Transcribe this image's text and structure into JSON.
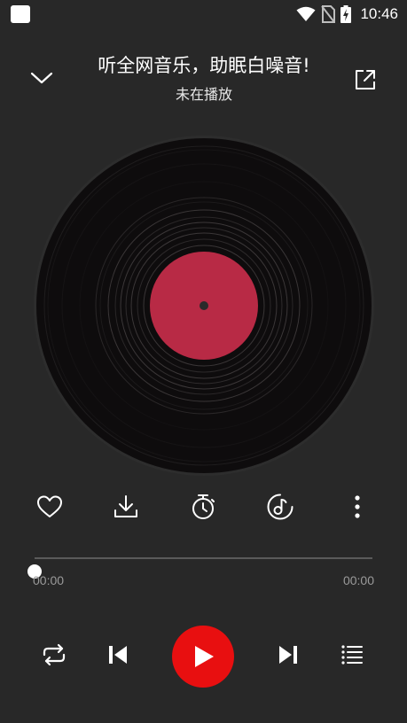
{
  "status_bar": {
    "time": "10:46",
    "icons": [
      "app-notification-icon",
      "wifi-icon",
      "no-sim-icon",
      "battery-charging-icon"
    ]
  },
  "header": {
    "title": "听全网音乐，助眠白噪音!",
    "subtitle": "未在播放",
    "left_icon": "chevron-down-icon",
    "right_icon": "share-external-icon"
  },
  "disc": {
    "label_color": "#b82a45",
    "disc_color": "#0e0c0d"
  },
  "actions": [
    {
      "name": "favorite",
      "icon": "heart-icon"
    },
    {
      "name": "download",
      "icon": "download-icon"
    },
    {
      "name": "sleep-timer",
      "icon": "timer-icon"
    },
    {
      "name": "audio-effect",
      "icon": "music-note-circle-icon"
    },
    {
      "name": "more",
      "icon": "more-vertical-icon"
    }
  ],
  "progress": {
    "current": "00:00",
    "total": "00:00",
    "fraction": 0
  },
  "transport": {
    "icons": [
      "repeat-icon",
      "previous-icon",
      "play-icon",
      "next-icon",
      "playlist-icon"
    ],
    "play_color": "#e80f10"
  }
}
